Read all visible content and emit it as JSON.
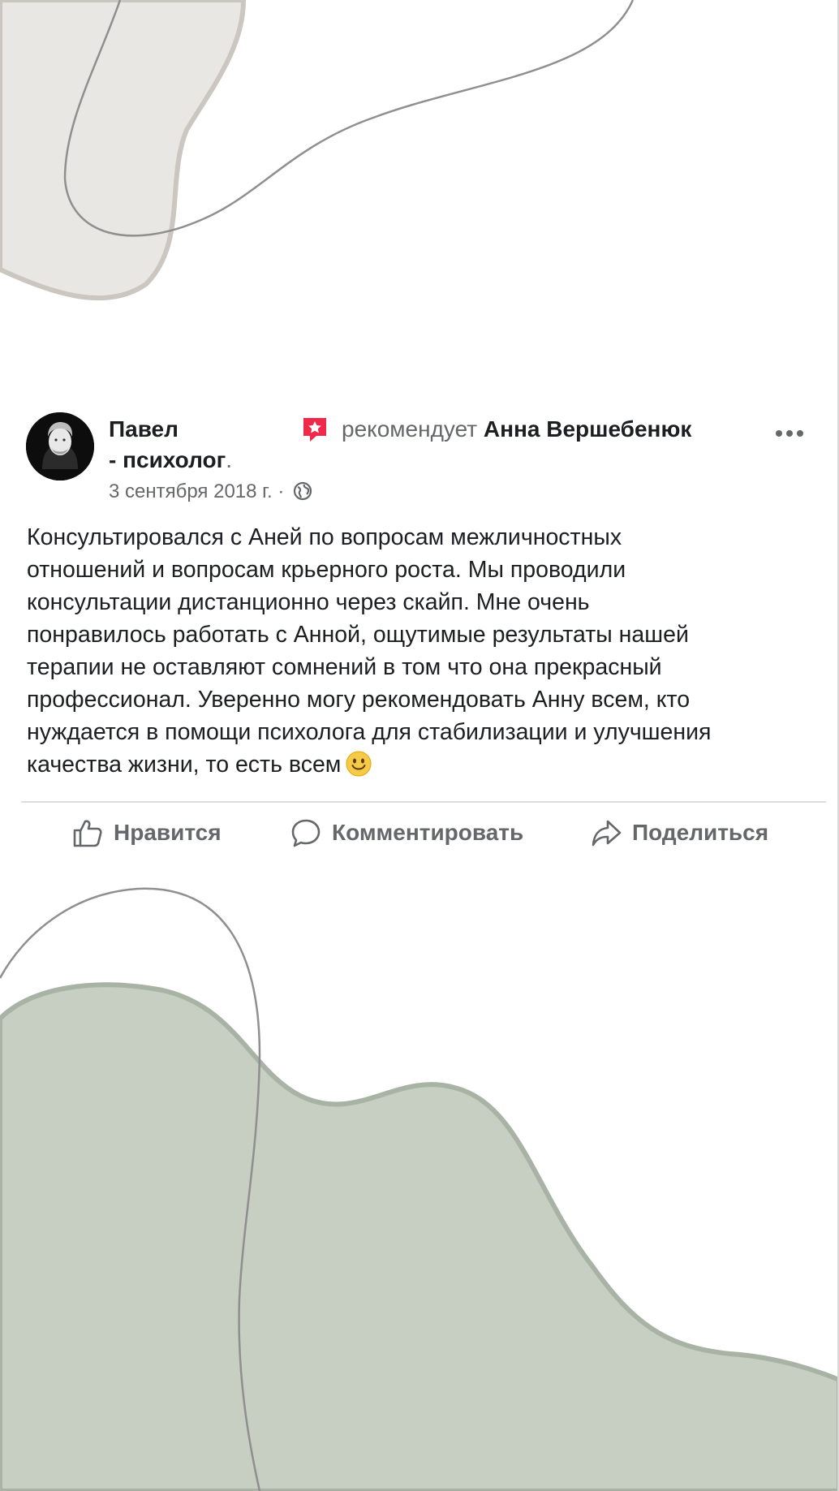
{
  "post": {
    "author_line1": "Павел",
    "author_line2": "- психолог",
    "author_dot": ".",
    "recommends_verb": "рекомендует",
    "recommended_name": "Анна Вершебенюк",
    "date": "3 сентября 2018 г. ·",
    "body_lines": [
      "Консультировался с Аней по вопросам межличностных",
      "отношений и вопросам крьерного роста. Мы проводили",
      "консультации дистанционно через скайп. Мне очень",
      "понравилось работать с Анной, ощутимые результаты нашей",
      "терапии не оставляют сомнений в том что она прекрасный",
      "профессионал. Уверенно могу рекомендовать Анну всем, кто",
      "нуждается в помощи психолога для стабилизации и улучшения",
      "качества жизни, то есть всем"
    ],
    "emoji": "smiling-face-emoji"
  },
  "actions": {
    "like_label": "Нравится",
    "comment_label": "Комментировать",
    "share_label": "Поделиться"
  },
  "icons": {
    "recommend": "recommend-star-icon",
    "more": "more-options-icon",
    "privacy": "globe-icon",
    "like": "thumbs-up-icon",
    "comment": "comment-bubble-icon",
    "share": "share-arrow-icon"
  },
  "colors": {
    "text_primary": "#1c1e21",
    "text_secondary": "#65676b",
    "recommend_red": "#f02849",
    "divider": "#dadde1",
    "blob_top": "#e9e7e3",
    "blob_bottom": "#c7cec2"
  }
}
